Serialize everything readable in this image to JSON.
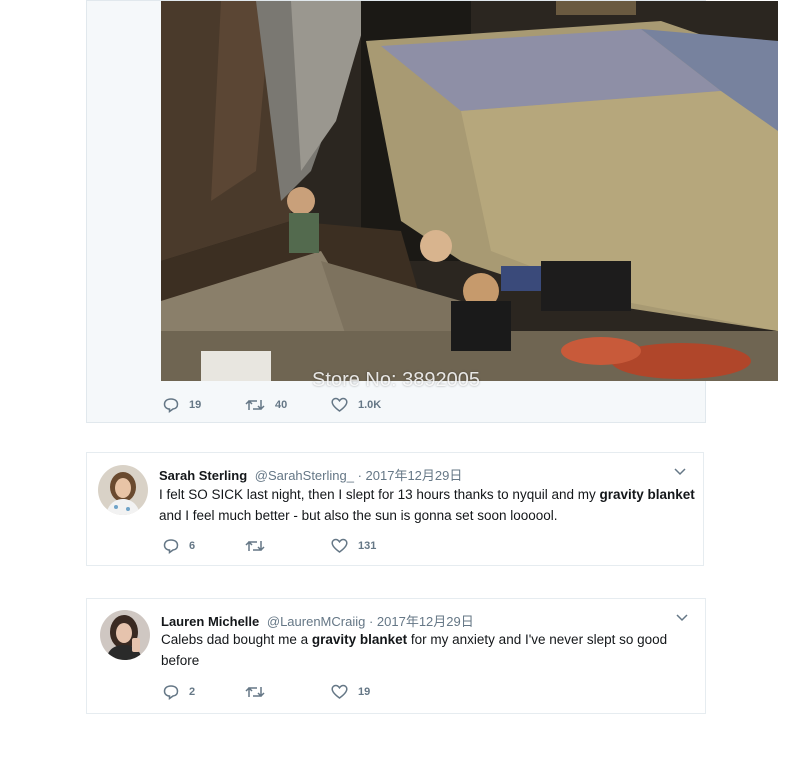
{
  "watermark": "Store No: 3892005",
  "top_tweet": {
    "actions": {
      "reply_count": "19",
      "retweet_count": "40",
      "like_count": "1.0K"
    }
  },
  "tweets": [
    {
      "name": "Sarah Sterling",
      "handle": "@SarahSterling_",
      "date": "· 2017年12月29日",
      "text_parts": [
        "I felt SO SICK last night, then I slept for 13 hours thanks to nyquil and my ",
        "gravity blanket",
        " and I feel much better - but also the sun is gonna set soon loooool."
      ],
      "actions": {
        "reply_count": "6",
        "retweet_count": "",
        "like_count": "131"
      }
    },
    {
      "name": "Lauren Michelle",
      "handle": "@LaurenMCraiig",
      "date": "· 2017年12月29日",
      "text_parts": [
        "Calebs dad bought me a ",
        "gravity blanket",
        " for my anxiety and I've never slept so good before"
      ],
      "actions": {
        "reply_count": "2",
        "retweet_count": "",
        "like_count": "19"
      }
    }
  ],
  "colors": {
    "icon": "#657786",
    "text": "#14171a",
    "border": "#e6ecf0"
  }
}
